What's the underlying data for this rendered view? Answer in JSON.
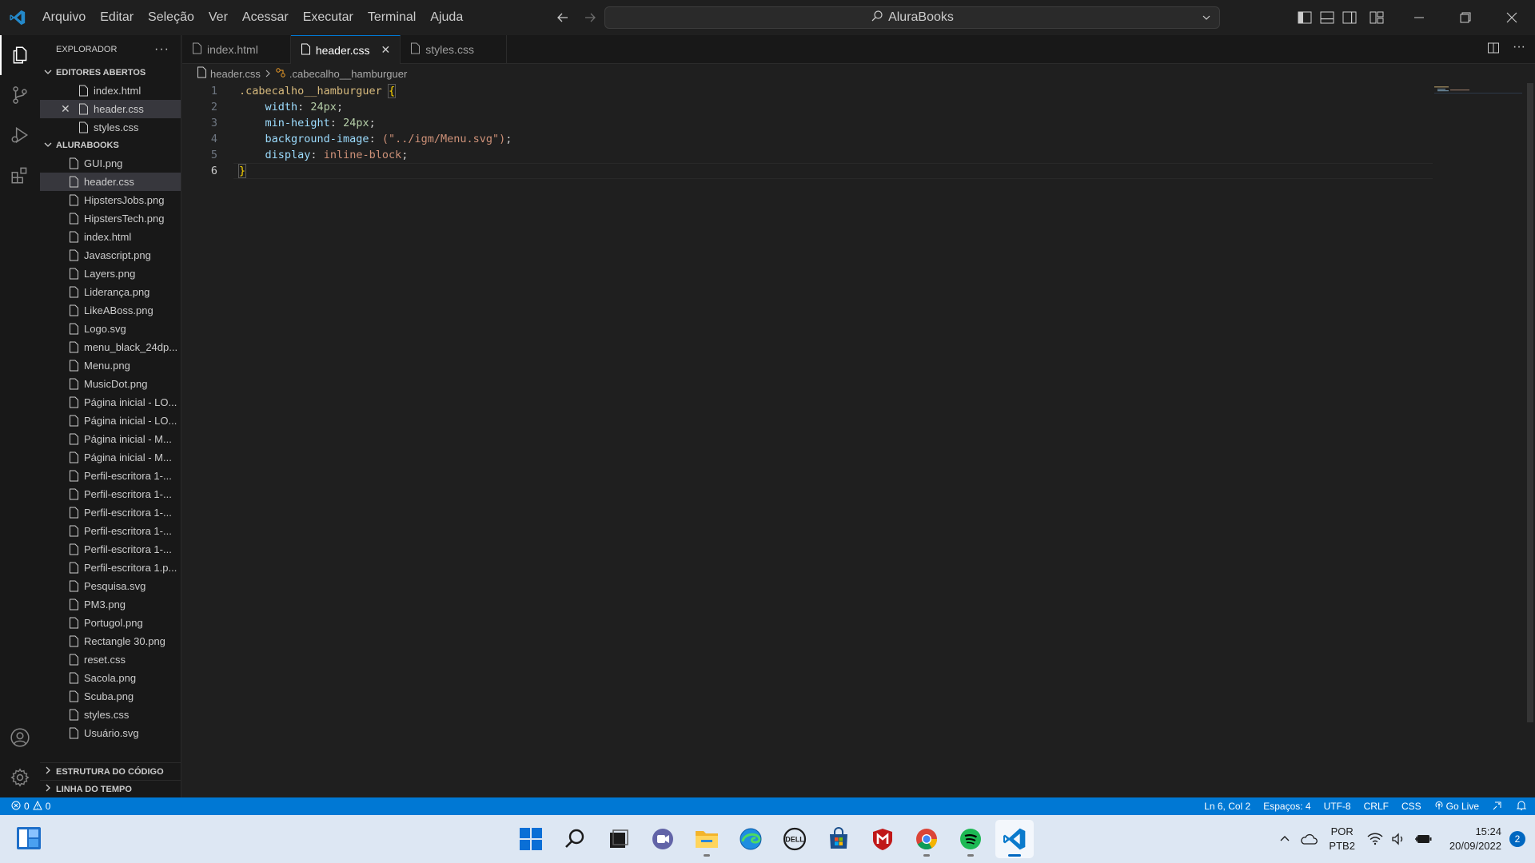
{
  "titlebar": {
    "menu": [
      "Arquivo",
      "Editar",
      "Seleção",
      "Ver",
      "Acessar",
      "Executar",
      "Terminal",
      "Ajuda"
    ],
    "search_text": "AluraBooks"
  },
  "sidebar": {
    "title": "EXPLORADOR",
    "open_editors_label": "EDITORES ABERTOS",
    "open_editors": [
      "index.html",
      "header.css",
      "styles.css"
    ],
    "folder_label": "ALURABOOKS",
    "files": [
      "GUI.png",
      "header.css",
      "HipstersJobs.png",
      "HipstersTech.png",
      "index.html",
      "Javascript.png",
      "Layers.png",
      "Liderança.png",
      "LikeABoss.png",
      "Logo.svg",
      "menu_black_24dp...",
      "Menu.png",
      "MusicDot.png",
      "Página inicial - LO...",
      "Página inicial - LO...",
      "Página inicial - M...",
      "Página inicial - M...",
      "Perfil-escritora 1-...",
      "Perfil-escritora 1-...",
      "Perfil-escritora 1-...",
      "Perfil-escritora 1-...",
      "Perfil-escritora 1-...",
      "Perfil-escritora 1.p...",
      "Pesquisa.svg",
      "PM3.png",
      "Portugol.png",
      "Rectangle 30.png",
      "reset.css",
      "Sacola.png",
      "Scuba.png",
      "styles.css",
      "Usuário.svg"
    ],
    "outline_label": "ESTRUTURA DO CÓDIGO",
    "timeline_label": "LINHA DO TEMPO"
  },
  "tabs": [
    "index.html",
    "header.css",
    "styles.css"
  ],
  "breadcrumb": {
    "file": "header.css",
    "symbol": ".cabecalho__hamburguer"
  },
  "code": {
    "line_numbers": [
      "1",
      "2",
      "3",
      "4",
      "5",
      "6"
    ],
    "selector": ".cabecalho__hamburguer",
    "open_brace": "{",
    "close_brace": "}",
    "p1": "width",
    "v1": "24px",
    "p2": "min-height",
    "v2": "24px",
    "p3": "background-image",
    "v3": "(\"../igm/Menu.svg\")",
    "p4": "display",
    "v4": "inline-block"
  },
  "statusbar": {
    "errors": "0",
    "warnings": "0",
    "position": "Ln 6, Col 2",
    "spaces": "Espaços: 4",
    "encoding": "UTF-8",
    "eol": "CRLF",
    "language": "CSS",
    "golive": "Go Live"
  },
  "tray": {
    "lang1": "POR",
    "lang2": "PTB2",
    "time": "15:24",
    "date": "20/09/2022",
    "notifications": "2"
  },
  "colors": {
    "accent": "#0078d4",
    "selector": "#d7ba7d",
    "property": "#9cdcfe",
    "number": "#b5cea8",
    "string": "#ce9178"
  }
}
